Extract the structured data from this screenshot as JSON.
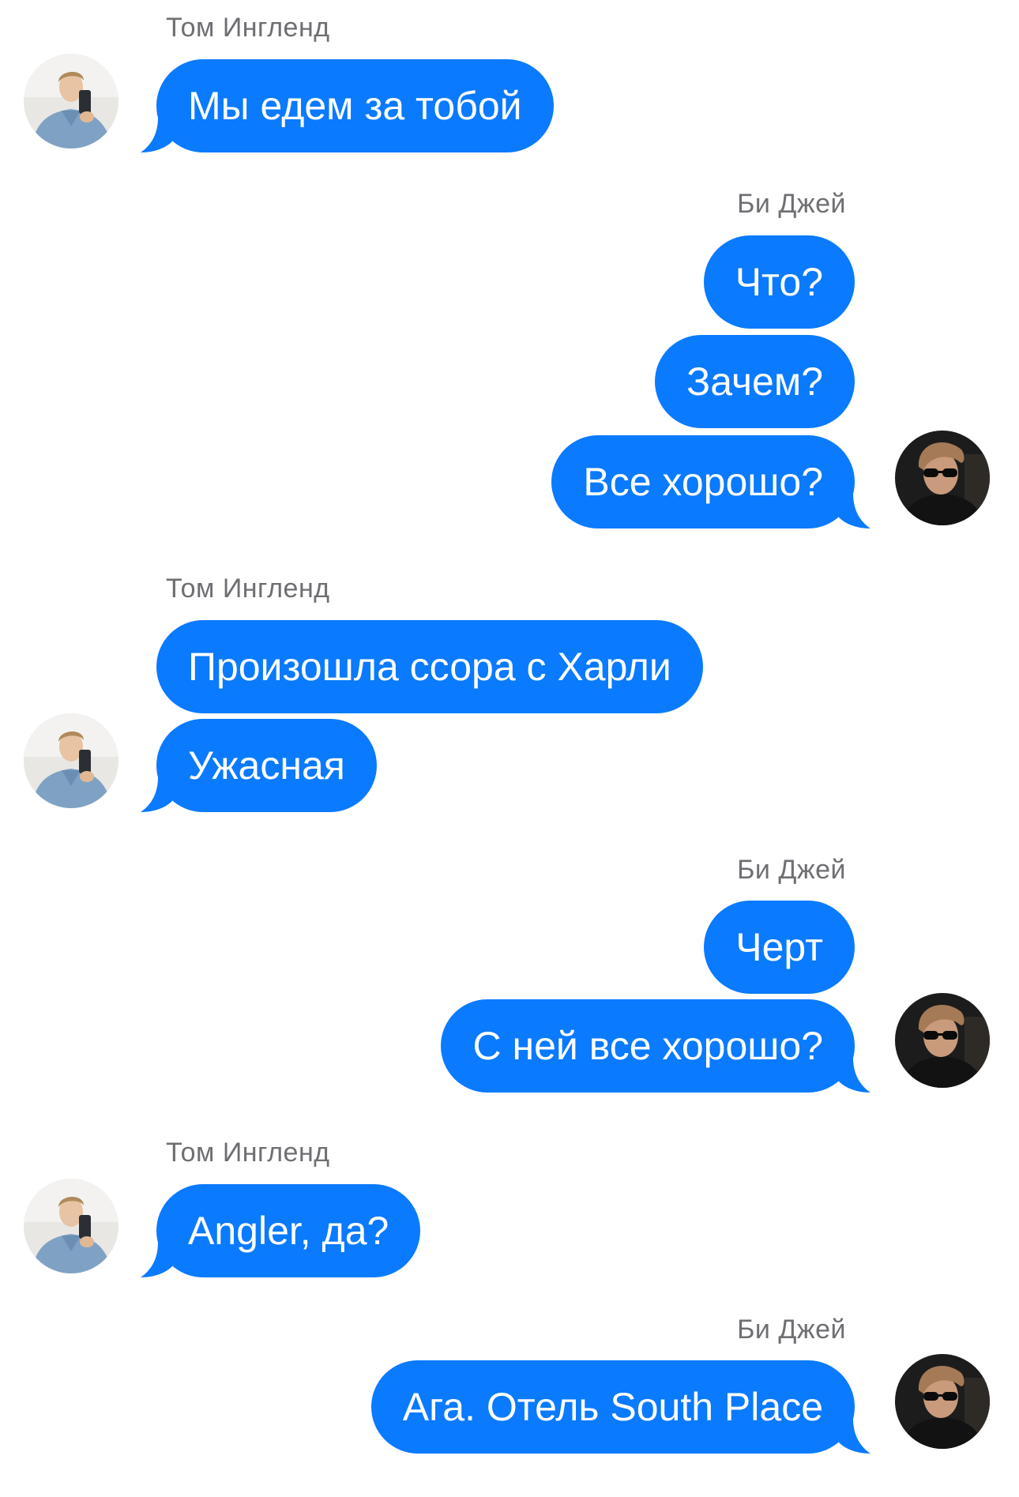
{
  "conversation": {
    "sender_left": "Том Ингленд",
    "sender_right": "Би Джей",
    "messages": [
      {
        "text": "Мы едем за тобой"
      },
      {
        "text": "Что?"
      },
      {
        "text": "Зачем?"
      },
      {
        "text": "Все хорошо?"
      },
      {
        "text": "Произошла ссора с Харли"
      },
      {
        "text": "Ужасная"
      },
      {
        "text": "Черт"
      },
      {
        "text": "С ней все хорошо?"
      },
      {
        "text": "Angler, да?"
      },
      {
        "text": "Ага. Отель South Place"
      }
    ]
  },
  "colors": {
    "bubble": "#0a7aff",
    "bubble_text": "#ffffff",
    "sender_name": "#6e6e73"
  }
}
